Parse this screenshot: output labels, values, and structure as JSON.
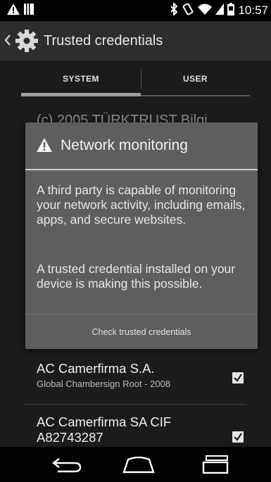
{
  "status_bar": {
    "time": "10:57",
    "left_icons": [
      "warning-icon",
      "notification-icon"
    ],
    "right_icons": [
      "bluetooth-icon",
      "vibrate-icon",
      "wifi-icon",
      "signal-icon",
      "battery-icon"
    ]
  },
  "action_bar": {
    "title": "Trusted credentials",
    "icon": "gear-icon"
  },
  "tabs": {
    "system": "SYSTEM",
    "user": "USER",
    "selected": "SYSTEM"
  },
  "list_peek": {
    "title": "(c) 2005 TÜRKTRUST Bilgi"
  },
  "dialog": {
    "title": "Network monitoring",
    "icon": "warning-icon",
    "message_1": "A third party is capable of monitoring your network activity, including emails, apps, and secure websites.",
    "message_2": "A trusted credential installed on your device is making this possible.",
    "button": "Check trusted credentials"
  },
  "list": {
    "items": [
      {
        "title": "AC Camerfirma S.A.",
        "subtitle": "Global Chambersign Root - 2008",
        "checked": true
      },
      {
        "title": "AC Camerfirma SA CIF A82743287",
        "subtitle": "",
        "checked": true
      }
    ]
  },
  "nav_bar": {
    "buttons": [
      "back-icon",
      "home-icon",
      "recents-icon"
    ]
  }
}
